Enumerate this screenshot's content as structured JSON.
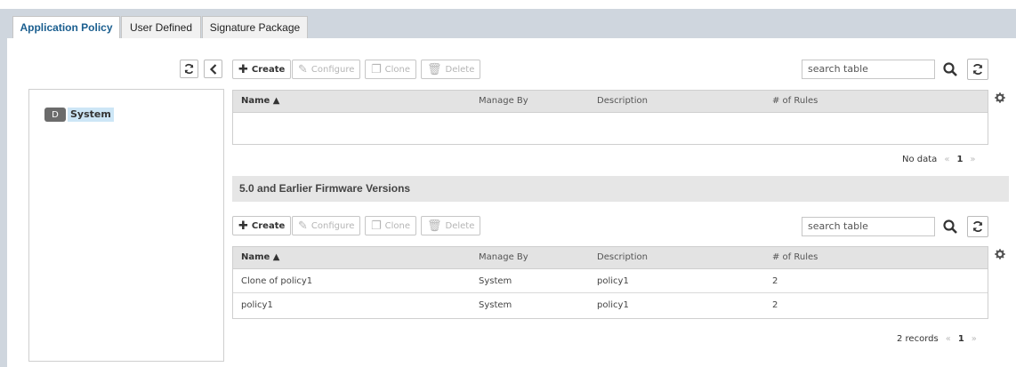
{
  "tabs": [
    {
      "label": "Application Policy",
      "active": true
    },
    {
      "label": "User Defined",
      "active": false
    },
    {
      "label": "Signature Package",
      "active": false
    }
  ],
  "tree": {
    "badge": "D",
    "root_label": "System"
  },
  "toolbar": {
    "create": "Create",
    "configure": "Configure",
    "clone": "Clone",
    "delete": "Delete",
    "search_placeholder": "search table"
  },
  "table1": {
    "columns": [
      "Name ▲",
      "Manage By",
      "Description",
      "# of Rules"
    ],
    "rows": [],
    "pager": {
      "status": "No data",
      "prev": "«",
      "page": "1",
      "next": "»"
    }
  },
  "section2": {
    "title": "5.0 and Earlier Firmware Versions"
  },
  "table2": {
    "columns": [
      "Name ▲",
      "Manage By",
      "Description",
      "# of Rules"
    ],
    "rows": [
      [
        "Clone of policy1",
        "System",
        "policy1",
        "2"
      ],
      [
        "policy1",
        "System",
        "policy1",
        "2"
      ]
    ],
    "pager": {
      "status": "2 records",
      "prev": "«",
      "page": "1",
      "next": "»"
    }
  },
  "colors": {
    "accent": "#1a5e8f",
    "tab_strip": "#cfd6de",
    "header_bg": "#e3e3e3"
  },
  "icons": [
    "refresh-icon",
    "collapse-left-icon",
    "plus-icon",
    "pencil-icon",
    "clone-icon",
    "trash-icon",
    "search-icon",
    "gear-icon"
  ]
}
